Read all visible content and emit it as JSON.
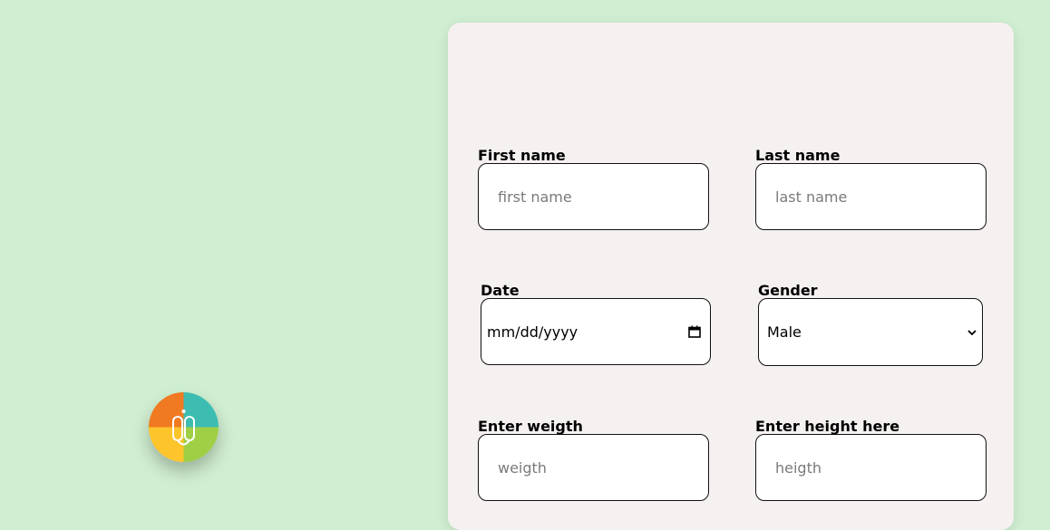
{
  "logo": {
    "name": "app-logo",
    "colors": {
      "top_left": "#f07a22",
      "top_right": "#3dbdb1",
      "bottom_left": "#fdc42c",
      "bottom_right": "#9ecf45"
    }
  },
  "form": {
    "first_name": {
      "label": "First name",
      "placeholder": "first name"
    },
    "last_name": {
      "label": "Last name",
      "placeholder": "last name"
    },
    "date": {
      "label": "Date",
      "value": "mm/dd/yyyy"
    },
    "gender": {
      "label": "Gender",
      "value": "Male"
    },
    "weight": {
      "label": "Enter weigth",
      "placeholder": "weigth"
    },
    "height": {
      "label": "Enter height here",
      "placeholder": "heigth"
    }
  },
  "colors": {
    "page_background": "#d0eed1",
    "card_background": "#f5f1f0"
  },
  "icons": {
    "date": "calendar-icon",
    "gender": "chevron-down-icon"
  }
}
